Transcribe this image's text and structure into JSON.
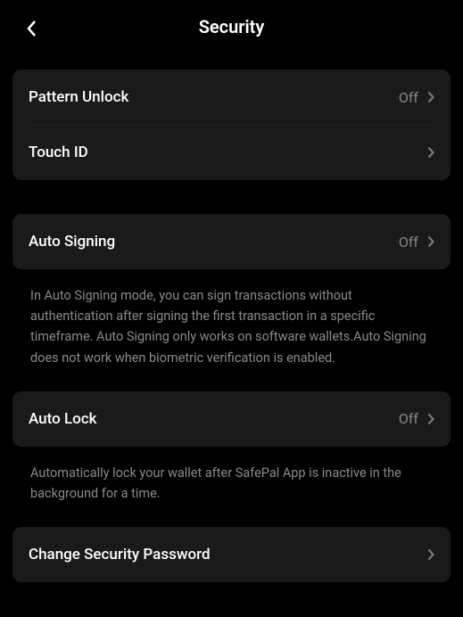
{
  "header": {
    "title": "Security"
  },
  "items": {
    "patternUnlock": {
      "label": "Pattern Unlock",
      "value": "Off"
    },
    "touchId": {
      "label": "Touch ID"
    },
    "autoSigning": {
      "label": "Auto Signing",
      "value": "Off",
      "description": "In Auto Signing mode, you can sign transactions without authentication after signing the first transaction in a specific timeframe. Auto Signing only works on software wallets.Auto Signing does not work when biometric verification is enabled."
    },
    "autoLock": {
      "label": "Auto Lock",
      "value": "Off",
      "description": "Automatically lock your wallet after SafePal App is inactive in the background for a time."
    },
    "changePassword": {
      "label": "Change Security Password"
    }
  }
}
